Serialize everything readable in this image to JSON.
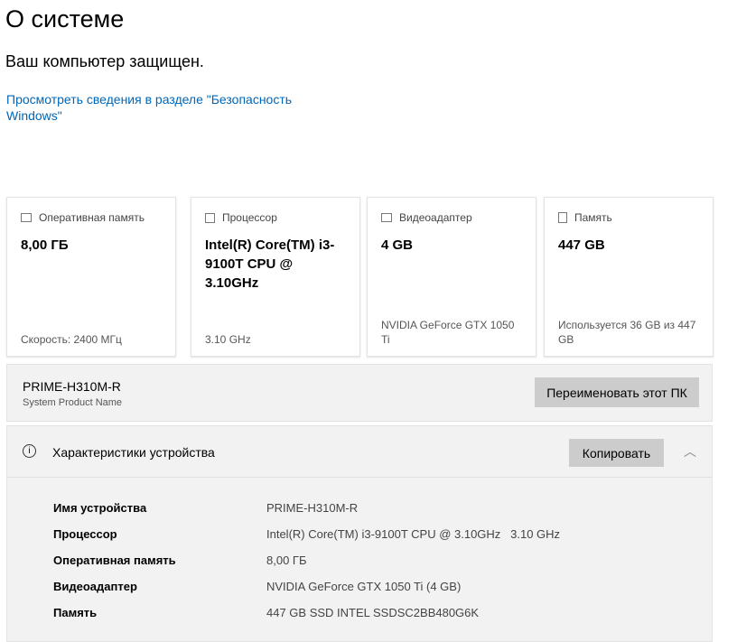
{
  "title": "О системе",
  "status": "Ваш компьютер защищен.",
  "security_link": "Просмотреть сведения в разделе \"Безопасность Windows\"",
  "cards": [
    {
      "icon": "ram-icon",
      "label": "Оперативная память",
      "value": "8,00 ГБ",
      "sub": "Скорость: 2400 МГц"
    },
    {
      "icon": "cpu-icon",
      "label": "Процессор",
      "value": "Intel(R) Core(TM) i3-9100T CPU @ 3.10GHz",
      "sub": "3.10 GHz"
    },
    {
      "icon": "gpu-icon",
      "label": "Видеоадаптер",
      "value": "4 GB",
      "sub": "NVIDIA GeForce GTX 1050 Ti"
    },
    {
      "icon": "storage-icon",
      "label": "Память",
      "value": "447 GB",
      "sub": "Используется 36 GB из 447 GB"
    }
  ],
  "pc": {
    "name": "PRIME-H310M-R",
    "caption": "System Product Name",
    "rename_label": "Переименовать этот ПК"
  },
  "specs": {
    "title": "Характеристики устройства",
    "copy_label": "Копировать",
    "rows": [
      {
        "k": "Имя устройства",
        "v": "PRIME-H310M-R"
      },
      {
        "k": "Процессор",
        "v": "Intel(R) Core(TM) i3-9100T CPU @ 3.10GHz   3.10 GHz"
      },
      {
        "k": "Оперативная память",
        "v": "8,00 ГБ"
      },
      {
        "k": "Видеоадаптер",
        "v": "NVIDIA GeForce GTX 1050 Ti (4 GB)"
      },
      {
        "k": "Память",
        "v": "447 GB SSD INTEL SSDSC2BB480G6K"
      }
    ]
  }
}
